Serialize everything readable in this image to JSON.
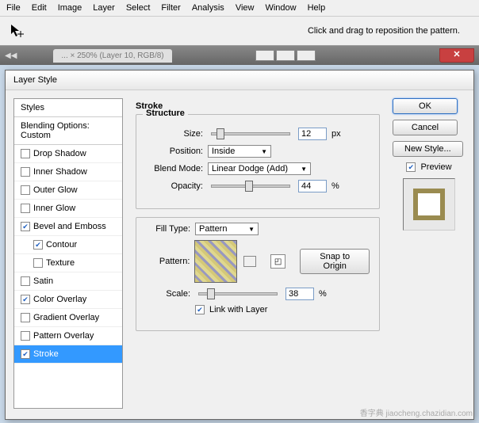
{
  "menu": [
    "File",
    "Edit",
    "Image",
    "Layer",
    "Select",
    "Filter",
    "Analysis",
    "View",
    "Window",
    "Help"
  ],
  "toolbar_hint": "Click and drag to reposition the pattern.",
  "doc_tab": "... × 250% (Layer 10, RGB/8)",
  "dialog": {
    "title": "Layer Style",
    "styles_header": "Styles",
    "blending": "Blending Options: Custom",
    "effects": [
      {
        "label": "Drop Shadow",
        "checked": false
      },
      {
        "label": "Inner Shadow",
        "checked": false
      },
      {
        "label": "Outer Glow",
        "checked": false
      },
      {
        "label": "Inner Glow",
        "checked": false
      },
      {
        "label": "Bevel and Emboss",
        "checked": true
      },
      {
        "label": "Contour",
        "checked": true,
        "indent": true
      },
      {
        "label": "Texture",
        "checked": false,
        "indent": true
      },
      {
        "label": "Satin",
        "checked": false
      },
      {
        "label": "Color Overlay",
        "checked": true
      },
      {
        "label": "Gradient Overlay",
        "checked": false
      },
      {
        "label": "Pattern Overlay",
        "checked": false
      },
      {
        "label": "Stroke",
        "checked": true,
        "selected": true
      }
    ],
    "panel_title": "Stroke",
    "structure": {
      "title": "Structure",
      "size_label": "Size:",
      "size": "12",
      "size_unit": "px",
      "position_label": "Position:",
      "position": "Inside",
      "blendmode_label": "Blend Mode:",
      "blendmode": "Linear Dodge (Add)",
      "opacity_label": "Opacity:",
      "opacity": "44",
      "opacity_unit": "%"
    },
    "fill": {
      "filltype_label": "Fill Type:",
      "filltype": "Pattern",
      "pattern_label": "Pattern:",
      "snap": "Snap to Origin",
      "scale_label": "Scale:",
      "scale": "38",
      "scale_unit": "%",
      "link": "Link with Layer"
    },
    "buttons": {
      "ok": "OK",
      "cancel": "Cancel",
      "newstyle": "New Style...",
      "preview": "Preview"
    }
  },
  "watermark": "香字典 jiaocheng.chazidian.com"
}
